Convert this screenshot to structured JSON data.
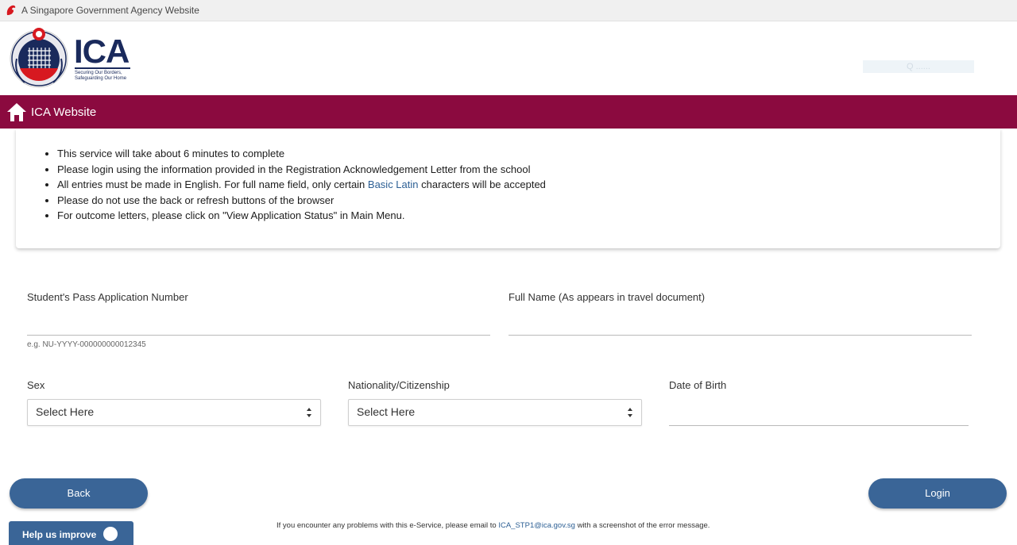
{
  "masthead": {
    "text": "A Singapore Government Agency Website"
  },
  "header": {
    "logo_word": "ICA",
    "logo_tagline": "Securing Our Borders, Safeguarding Our Home",
    "ghost_text": "Q ......"
  },
  "navbar": {
    "home_link": "ICA Website"
  },
  "info": {
    "items": [
      "This service will take about 6 minutes to complete",
      "Please login using the information provided in the Registration Acknowledgement Letter from the school"
    ],
    "item3_before": "All entries must be made in English. For full name field, only certain ",
    "item3_link": "Basic Latin",
    "item3_after": " characters will be accepted",
    "item4": "Please do not use the back or refresh buttons of the browser",
    "item5": "For outcome letters, please click on \"View Application Status\" in Main Menu."
  },
  "form": {
    "app_number": {
      "label": "Student's Pass Application Number",
      "value": "",
      "hint": "e.g. NU-YYYY-000000000012345"
    },
    "full_name": {
      "label": "Full Name (As appears in travel document)",
      "value": ""
    },
    "sex": {
      "label": "Sex",
      "selected": "Select Here"
    },
    "nationality": {
      "label": "Nationality/Citizenship",
      "selected": "Select Here"
    },
    "dob": {
      "label": "Date of Birth",
      "value": ""
    }
  },
  "buttons": {
    "back": "Back",
    "login": "Login",
    "help": "Help us improve"
  },
  "footer": {
    "before": "If you encounter any problems with this e-Service, please email to ",
    "email": "ICA_STP1@ica.gov.sg",
    "after": " with a screenshot of the error message."
  },
  "colors": {
    "navbar": "#8b0a3f",
    "button": "#3a6597",
    "link": "#2c5f94"
  }
}
